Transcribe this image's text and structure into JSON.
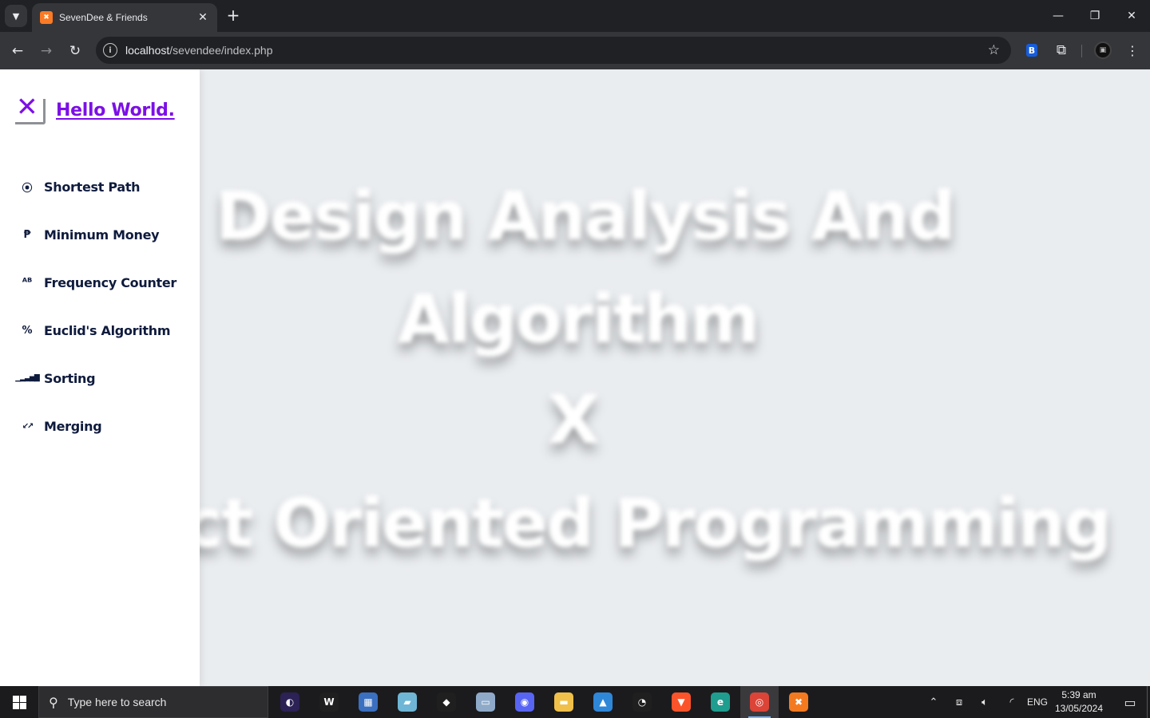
{
  "browser": {
    "tab": {
      "title": "SevenDee & Friends",
      "favicon": "xampp-icon",
      "close": "✕"
    },
    "new_tab": "+",
    "window": {
      "minimize": "—",
      "restore": "❐",
      "close": "✕"
    },
    "url_host": "localhost",
    "url_path": "/sevendee/index.php"
  },
  "sidebar": {
    "logo_mark": "✕",
    "logo_text": "Hello World.",
    "items": [
      {
        "label": "Shortest Path",
        "icon": "route-icon",
        "glyph": "⦿"
      },
      {
        "label": "Minimum Money",
        "icon": "peso-icon",
        "glyph": "₱"
      },
      {
        "label": "Frequency Counter",
        "icon": "spellcheck-icon",
        "glyph": "ᴬᴮ"
      },
      {
        "label": "Euclid's Algorithm",
        "icon": "percent-icon",
        "glyph": "%"
      },
      {
        "label": "Sorting",
        "icon": "bars-icon",
        "glyph": "▁▂▃▅▇"
      },
      {
        "label": "Merging",
        "icon": "merge-arrows-icon",
        "glyph": "↙↗"
      }
    ]
  },
  "hero": {
    "line1": "Design Analysis And",
    "line2": "Algorithm",
    "line3": "X",
    "line4": "Object Oriented Programming"
  },
  "taskbar": {
    "search_placeholder": "Type here to search",
    "language": "ENG",
    "time": "5:39 am",
    "date": "13/05/2024",
    "apps": [
      {
        "name": "eclipse",
        "color": "#2c2255",
        "glyph": "◐"
      },
      {
        "name": "wamp",
        "color": "#1f1f1f",
        "glyph": "W"
      },
      {
        "name": "calculator",
        "color": "#3b6fbf",
        "glyph": "▦"
      },
      {
        "name": "notes",
        "color": "#6fb6d6",
        "glyph": "▰"
      },
      {
        "name": "sourcetree",
        "color": "#1f1f1f",
        "glyph": "◆"
      },
      {
        "name": "monitor",
        "color": "#8faac9",
        "glyph": "▭"
      },
      {
        "name": "discord",
        "color": "#5865f2",
        "glyph": "◉"
      },
      {
        "name": "file-explorer",
        "color": "#f0c04a",
        "glyph": "▬"
      },
      {
        "name": "photos",
        "color": "#2f87d8",
        "glyph": "▲"
      },
      {
        "name": "speedometer",
        "color": "#1f1f1f",
        "glyph": "◔"
      },
      {
        "name": "brave",
        "color": "#fb542b",
        "glyph": "▼"
      },
      {
        "name": "edge",
        "color": "#1f9d8f",
        "glyph": "e"
      },
      {
        "name": "chrome",
        "color": "#db4437",
        "glyph": "◎"
      },
      {
        "name": "xampp",
        "color": "#f47a20",
        "glyph": "✖"
      }
    ]
  }
}
